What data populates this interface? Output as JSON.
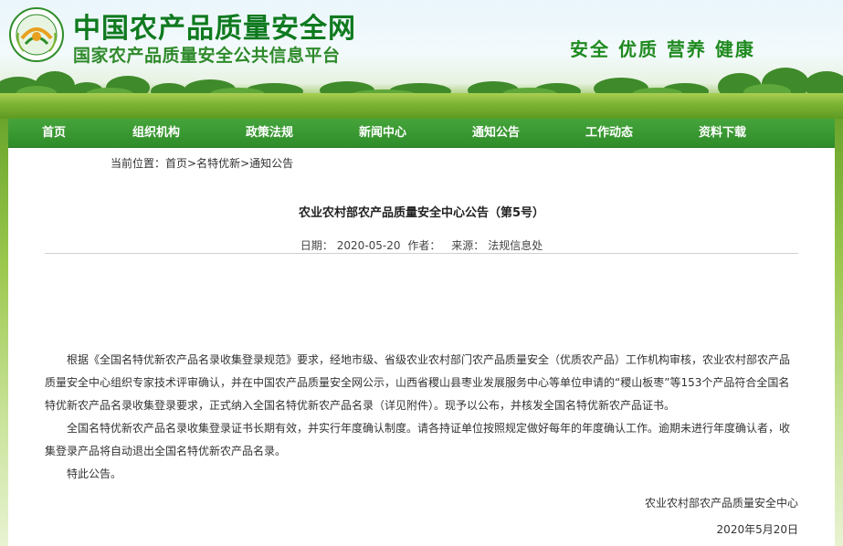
{
  "header": {
    "logo_text_top": "中国农产品质量安全中心",
    "logo_text_bottom": "CAQS",
    "title": "中国农产品质量安全网",
    "subtitle": "国家农产品质量安全公共信息平台",
    "slogan": "安全 优质 营养 健康"
  },
  "nav": {
    "items": [
      {
        "label": "首页"
      },
      {
        "label": "组织机构"
      },
      {
        "label": "政策法规"
      },
      {
        "label": "新闻中心"
      },
      {
        "label": "通知公告"
      },
      {
        "label": "工作动态"
      },
      {
        "label": "资料下载"
      }
    ]
  },
  "breadcrumb": {
    "prefix": "当前位置：",
    "items": [
      "首页",
      "名特优新",
      "通知公告"
    ],
    "separator": ">"
  },
  "article": {
    "title": "农业农村部农产品质量安全中心公告（第5号）",
    "meta": {
      "date_label": "日期：",
      "date": "2020-05-20",
      "author_label": "作者：",
      "author": "",
      "source_label": "来源：",
      "source": "法规信息处"
    },
    "paragraphs": [
      "根据《全国名特优新农产品名录收集登录规范》要求，经地市级、省级农业农村部门农产品质量安全（优质农产品）工作机构审核，农业农村部农产品质量安全中心组织专家技术评审确认，并在中国农产品质量安全网公示，山西省稷山县枣业发展服务中心等单位申请的“稷山板枣”等153个产品符合全国名特优新农产品名录收集登录要求，正式纳入全国名特优新农产品名录（详见附件）。现予以公布，并核发全国名特优新农产品证书。",
      "全国名特优新农产品名录收集登录证书长期有效，并实行年度确认制度。请各持证单位按照规定做好每年的年度确认工作。逾期未进行年度确认者，收集登录产品将自动退出全国名特优新农产品名录。",
      "特此公告。"
    ],
    "signature": "农业农村部农产品质量安全中心",
    "sign_date": "2020年5月20日"
  },
  "colors": {
    "nav_green": "#2f8d2a",
    "title_green": "#0f7a1f",
    "slogan_green": "#1f8a1f"
  }
}
